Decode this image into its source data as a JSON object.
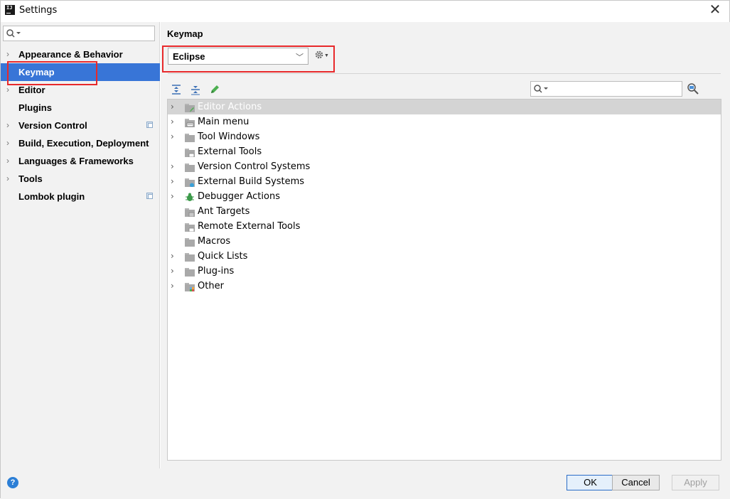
{
  "window": {
    "title": "Settings"
  },
  "sidebar": {
    "search_placeholder": "",
    "items": [
      {
        "label": "Appearance & Behavior",
        "expandable": true
      },
      {
        "label": "Keymap",
        "expandable": false,
        "selected": true
      },
      {
        "label": "Editor",
        "expandable": true
      },
      {
        "label": "Plugins",
        "expandable": false
      },
      {
        "label": "Version Control",
        "expandable": true,
        "project_icon": true
      },
      {
        "label": "Build, Execution, Deployment",
        "expandable": true
      },
      {
        "label": "Languages & Frameworks",
        "expandable": true
      },
      {
        "label": "Tools",
        "expandable": true
      },
      {
        "label": "Lombok plugin",
        "expandable": false,
        "project_icon": true
      }
    ]
  },
  "main": {
    "title": "Keymap",
    "keymap_value": "Eclipse",
    "search_placeholder": ""
  },
  "tree": {
    "items": [
      {
        "label": "Editor Actions",
        "expandable": true,
        "icon": "editor-actions-icon",
        "selected": true
      },
      {
        "label": "Main menu",
        "expandable": true,
        "icon": "main-menu-icon"
      },
      {
        "label": "Tool Windows",
        "expandable": true,
        "icon": "folder-icon"
      },
      {
        "label": "External Tools",
        "expandable": false,
        "icon": "external-tools-icon"
      },
      {
        "label": "Version Control Systems",
        "expandable": true,
        "icon": "folder-icon"
      },
      {
        "label": "External Build Systems",
        "expandable": true,
        "icon": "build-systems-icon"
      },
      {
        "label": "Debugger Actions",
        "expandable": true,
        "icon": "debugger-bug-icon"
      },
      {
        "label": "Ant Targets",
        "expandable": false,
        "icon": "ant-targets-icon"
      },
      {
        "label": "Remote External Tools",
        "expandable": false,
        "icon": "remote-tools-icon"
      },
      {
        "label": "Macros",
        "expandable": false,
        "icon": "folder-icon"
      },
      {
        "label": "Quick Lists",
        "expandable": true,
        "icon": "folder-icon"
      },
      {
        "label": "Plug-ins",
        "expandable": true,
        "icon": "folder-icon"
      },
      {
        "label": "Other",
        "expandable": true,
        "icon": "other-icon"
      }
    ]
  },
  "footer": {
    "help_label": "?",
    "ok_label": "OK",
    "cancel_label": "Cancel",
    "apply_label": "Apply"
  },
  "colors": {
    "selection": "#3875d7",
    "highlight_box": "#e8292b",
    "tree_selection": "#d4d4d4"
  }
}
